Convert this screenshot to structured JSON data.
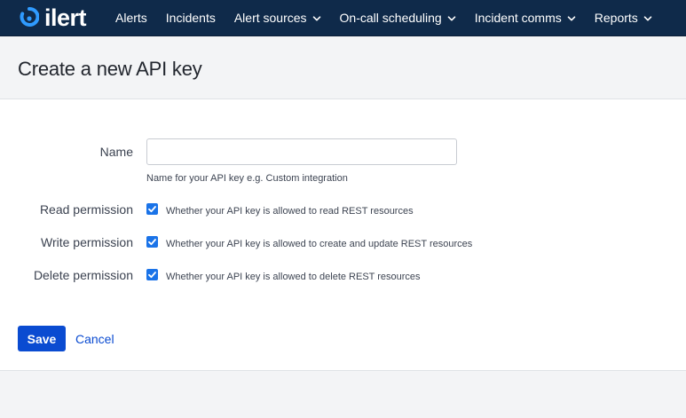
{
  "brand": {
    "name": "ilert",
    "logo_icon": "ilert-logo-icon",
    "nav_background": "#0f2a4a"
  },
  "nav": {
    "items": [
      {
        "label": "Alerts",
        "dropdown": false
      },
      {
        "label": "Incidents",
        "dropdown": false
      },
      {
        "label": "Alert sources",
        "dropdown": true
      },
      {
        "label": "On-call scheduling",
        "dropdown": true
      },
      {
        "label": "Incident comms",
        "dropdown": true
      },
      {
        "label": "Reports",
        "dropdown": true
      }
    ]
  },
  "page": {
    "title": "Create a new API key"
  },
  "form": {
    "name": {
      "label": "Name",
      "value": "",
      "placeholder": "",
      "help": "Name for your API key e.g. Custom integration"
    },
    "read_permission": {
      "label": "Read permission",
      "checked": true,
      "help": "Whether your API key is allowed to read REST resources"
    },
    "write_permission": {
      "label": "Write permission",
      "checked": true,
      "help": "Whether your API key is allowed to create and update REST resources"
    },
    "delete_permission": {
      "label": "Delete permission",
      "checked": true,
      "help": "Whether your API key is allowed to delete REST resources"
    },
    "actions": {
      "save_label": "Save",
      "cancel_label": "Cancel"
    }
  },
  "colors": {
    "primary": "#0a4bd1",
    "checkbox": "#1a73e8"
  }
}
